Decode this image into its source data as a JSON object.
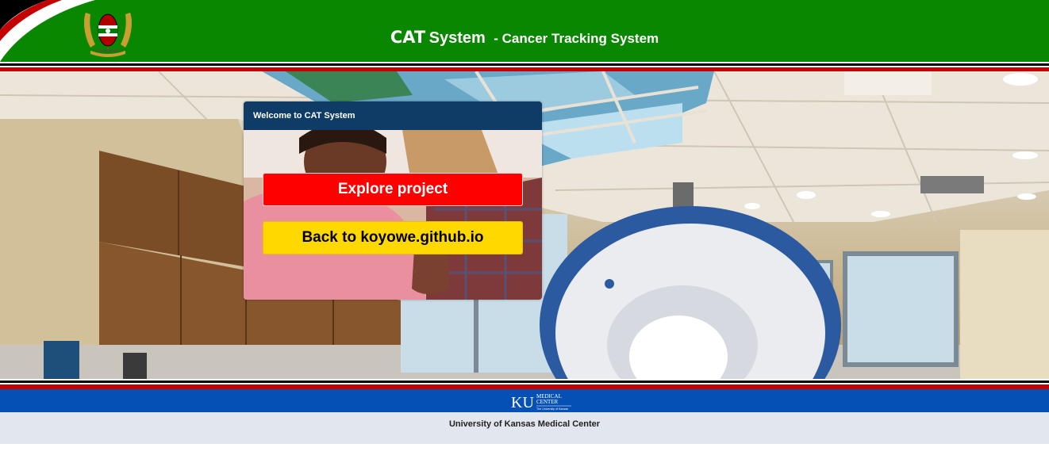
{
  "header": {
    "brand": "CAT",
    "system": "System",
    "subtitle": "- Cancer Tracking System",
    "logo_icon": "kenya-coat-of-arms-icon"
  },
  "welcome_card": {
    "title": "Welcome to CAT System",
    "explore_button": "Explore project",
    "back_button": "Back to koyowe.github.io"
  },
  "footer": {
    "logo": {
      "icon": "ku-medical-center-logo",
      "ku": "KU",
      "line1": "MEDICAL",
      "line2": "CENTER",
      "line3": "The University of Kansas"
    },
    "text": "University of Kansas Medical Center"
  },
  "colors": {
    "header_green": "#0a8700",
    "flag_red": "#c50000",
    "flag_black": "#000000",
    "card_header": "#0e3c66",
    "explore_button": "#ff0000",
    "back_button": "#ffd800",
    "footer_blue": "#0450b4",
    "footer_gray": "#e2e6ee"
  }
}
